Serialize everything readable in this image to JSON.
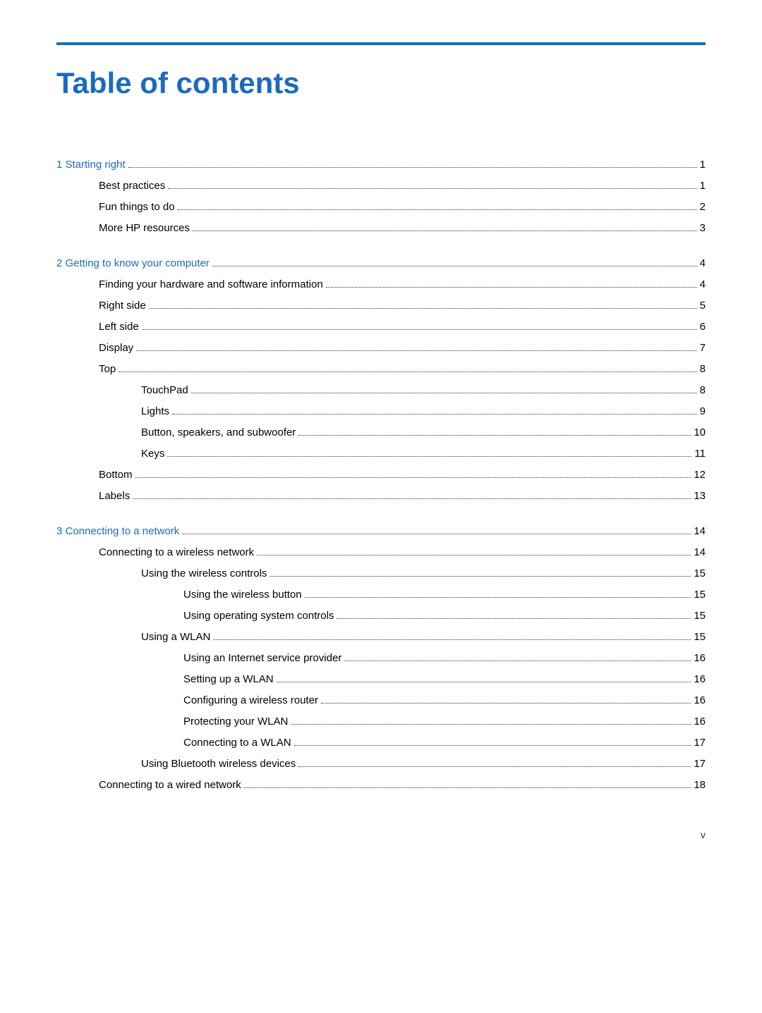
{
  "title": "Table of contents",
  "accent_color": "#1a6bbf",
  "footer_page": "v",
  "sections": [
    {
      "id": "section1",
      "level": 0,
      "text": "1  Starting right",
      "page": "1",
      "children": [
        {
          "level": 1,
          "text": "Best practices",
          "page": "1"
        },
        {
          "level": 1,
          "text": "Fun things to do",
          "page": "2"
        },
        {
          "level": 1,
          "text": "More HP resources",
          "page": "3"
        }
      ]
    },
    {
      "id": "section2",
      "level": 0,
      "text": "2  Getting to know your computer",
      "page": "4",
      "children": [
        {
          "level": 1,
          "text": "Finding your hardware and software information",
          "page": "4"
        },
        {
          "level": 1,
          "text": "Right side",
          "page": "5"
        },
        {
          "level": 1,
          "text": "Left side",
          "page": "6"
        },
        {
          "level": 1,
          "text": "Display",
          "page": "7"
        },
        {
          "level": 1,
          "text": "Top",
          "page": "8",
          "children": [
            {
              "level": 2,
              "text": "TouchPad",
              "page": "8"
            },
            {
              "level": 2,
              "text": "Lights",
              "page": "9"
            },
            {
              "level": 2,
              "text": "Button, speakers, and subwoofer",
              "page": "10"
            },
            {
              "level": 2,
              "text": "Keys",
              "page": "11"
            }
          ]
        },
        {
          "level": 1,
          "text": "Bottom",
          "page": "12"
        },
        {
          "level": 1,
          "text": "Labels",
          "page": "13"
        }
      ]
    },
    {
      "id": "section3",
      "level": 0,
      "text": "3  Connecting to a network",
      "page": "14",
      "children": [
        {
          "level": 1,
          "text": "Connecting to a wireless network",
          "page": "14",
          "children": [
            {
              "level": 2,
              "text": "Using the wireless controls",
              "page": "15",
              "children": [
                {
                  "level": 3,
                  "text": "Using the wireless button",
                  "page": "15"
                },
                {
                  "level": 3,
                  "text": "Using operating system controls",
                  "page": "15"
                }
              ]
            },
            {
              "level": 2,
              "text": "Using a WLAN",
              "page": "15",
              "children": [
                {
                  "level": 3,
                  "text": "Using an Internet service provider",
                  "page": "16"
                },
                {
                  "level": 3,
                  "text": "Setting up a WLAN",
                  "page": "16"
                },
                {
                  "level": 3,
                  "text": "Configuring a wireless router",
                  "page": "16"
                },
                {
                  "level": 3,
                  "text": "Protecting your WLAN",
                  "page": "16"
                },
                {
                  "level": 3,
                  "text": "Connecting to a WLAN",
                  "page": "17"
                }
              ]
            },
            {
              "level": 2,
              "text": "Using Bluetooth wireless devices",
              "page": "17"
            }
          ]
        },
        {
          "level": 1,
          "text": "Connecting to a wired network",
          "page": "18"
        }
      ]
    }
  ]
}
